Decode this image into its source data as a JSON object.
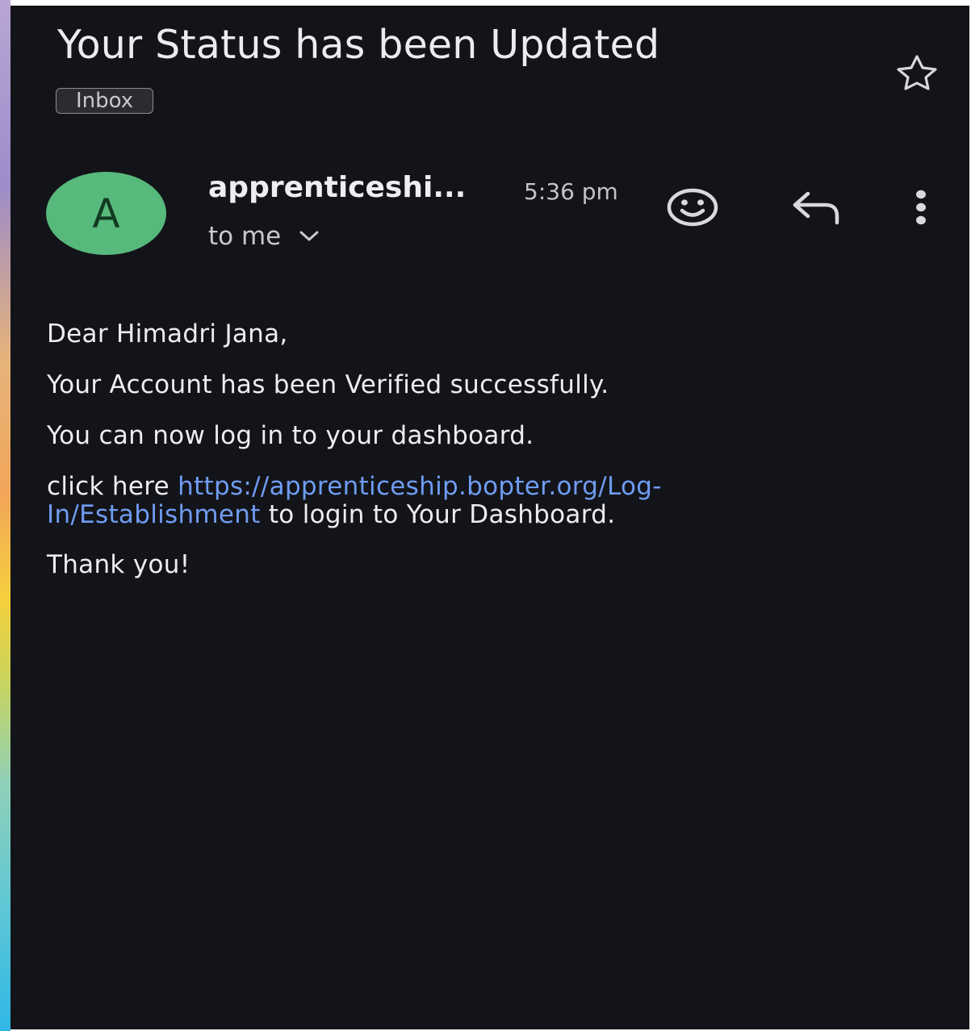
{
  "email": {
    "subject": "Your Status has been Updated",
    "label": "Inbox",
    "sender_initial": "A",
    "sender_name": "apprenticeshi...",
    "time": "5:36 pm",
    "recipient": "to me",
    "body": {
      "greeting": "Dear Himadri Jana,",
      "line1": "Your Account has been Verified successfully.",
      "line2": "You can now log in to your dashboard.",
      "link_prefix": "click here ",
      "link_text": "https://apprenticeship.bopter.org/Log-In/Establishment",
      "link_suffix": " to login to Your Dashboard.",
      "closing": "Thank you!"
    }
  },
  "icons": {
    "star": "star-outline-icon",
    "emoji": "add-reaction-icon",
    "reply": "reply-icon",
    "more": "more-vertical-icon",
    "expand": "chevron-down-icon"
  },
  "colors": {
    "background": "#131419",
    "avatar": "#57b97c",
    "link": "#6f9cf2"
  }
}
